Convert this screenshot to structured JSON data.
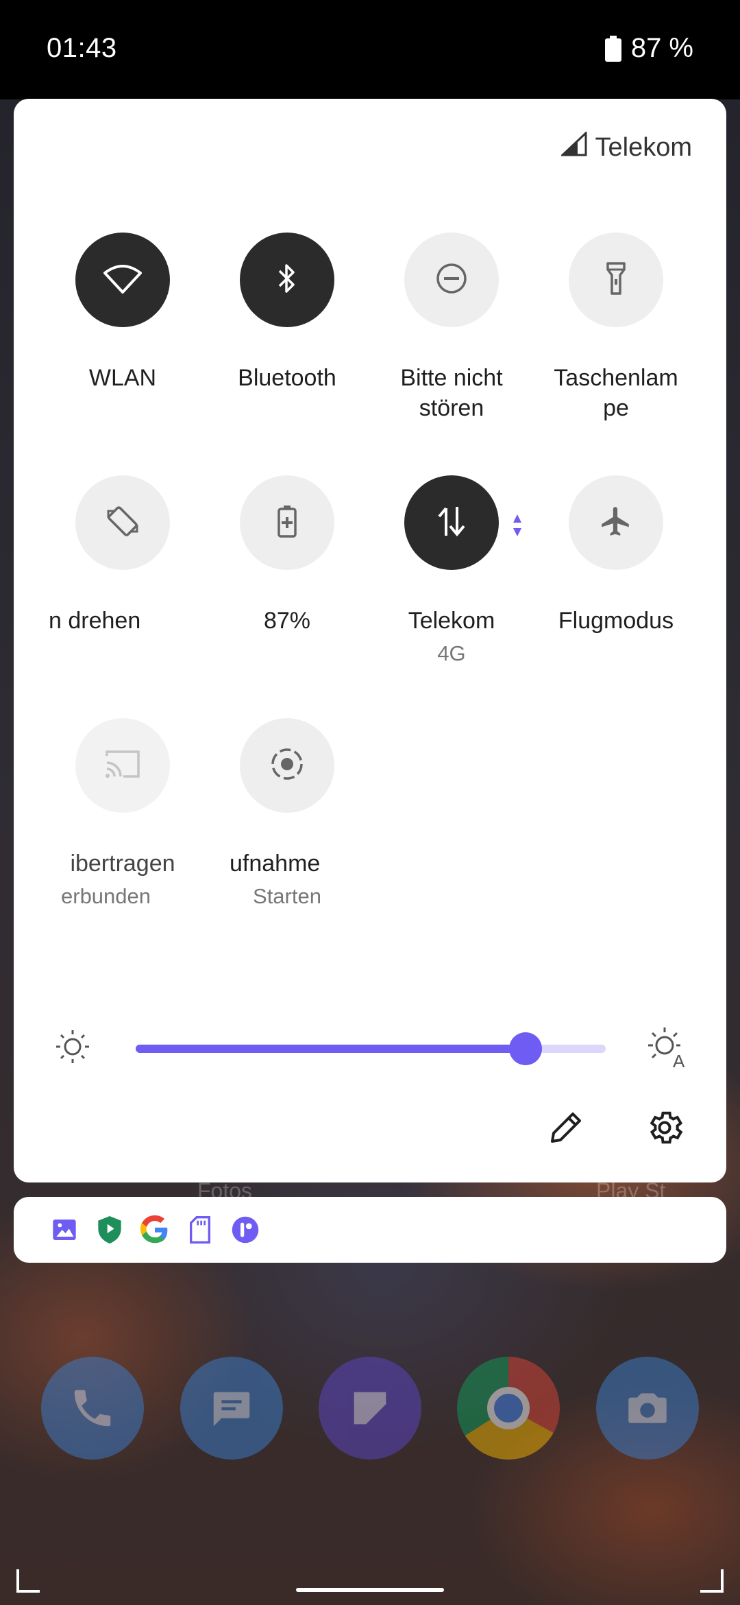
{
  "status_bar": {
    "time": "01:43",
    "battery_text": "87 %"
  },
  "carrier": {
    "name": "Telekom"
  },
  "tiles": [
    {
      "id": "wifi",
      "label": "WLAN",
      "sub": "",
      "state": "on",
      "icon": "wifi-icon"
    },
    {
      "id": "bluetooth",
      "label": "Bluetooth",
      "sub": "",
      "state": "on",
      "icon": "bluetooth-icon"
    },
    {
      "id": "dnd",
      "label": "Bitte nicht\nstören",
      "sub": "",
      "state": "off",
      "icon": "do-not-disturb-icon"
    },
    {
      "id": "flashlight",
      "label": "Taschenlam\npe",
      "sub": "",
      "state": "off",
      "icon": "flashlight-icon"
    },
    {
      "id": "rotate",
      "label": "n drehen",
      "sub": "",
      "state": "off",
      "icon": "auto-rotate-icon"
    },
    {
      "id": "battery_saver",
      "label": "87%",
      "sub": "",
      "state": "off",
      "icon": "battery-saver-icon"
    },
    {
      "id": "mobile_data",
      "label": "Telekom",
      "sub": "4G",
      "state": "on",
      "icon": "mobile-data-icon"
    },
    {
      "id": "airplane",
      "label": "Flugmodus",
      "sub": "",
      "state": "off",
      "icon": "airplane-icon"
    },
    {
      "id": "cast",
      "label": "ibertragen",
      "sub": "erbunden",
      "state": "unavailable",
      "icon": "cast-icon"
    },
    {
      "id": "screen_record",
      "label": "ufnahme",
      "sub": "Starten",
      "state": "off",
      "icon": "screen-record-icon"
    }
  ],
  "brightness": {
    "level": 0.83
  },
  "notification_icons": [
    "photos-icon",
    "play-protect-icon",
    "google-icon",
    "sd-card-icon",
    "app-badge-icon"
  ],
  "home": {
    "label_left": "Fotos",
    "label_right": "Play St"
  },
  "colors": {
    "accent": "#6f5cf2",
    "tile_on": "#2b2b2b",
    "tile_off": "#eeeeee"
  }
}
